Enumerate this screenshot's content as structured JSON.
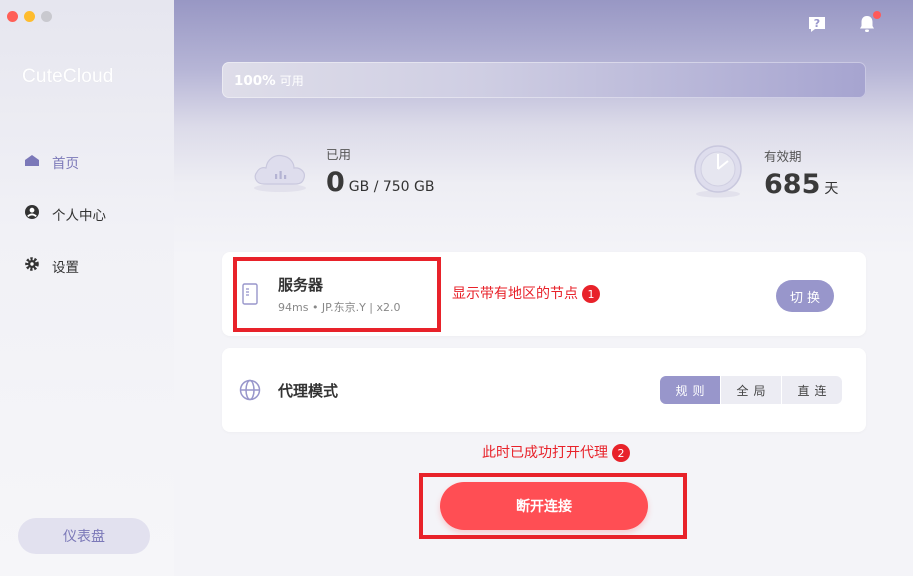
{
  "app": {
    "name": "CuteCloud"
  },
  "window_controls": {
    "colors": [
      "#ff5f57",
      "#febc2e",
      "#c9c9cf"
    ]
  },
  "sidebar": {
    "items": [
      {
        "label": "首页",
        "icon": "home-icon",
        "active": true
      },
      {
        "label": "个人中心",
        "icon": "user-icon",
        "active": false
      },
      {
        "label": "设置",
        "icon": "gear-icon",
        "active": false
      }
    ],
    "dashboard_label": "仪表盘"
  },
  "header": {
    "icons": [
      "help-icon",
      "bell-icon"
    ],
    "has_notification": true
  },
  "usage_bar": {
    "percent_text": "100%",
    "label": "可用",
    "available_fraction": 1.0
  },
  "stats": {
    "used": {
      "label": "已用",
      "value": "0",
      "unit": "GB / 750 GB"
    },
    "validity": {
      "label": "有效期",
      "value": "685",
      "unit": "天"
    }
  },
  "server": {
    "title": "服务器",
    "subtitle": "94ms • JP.东京.Y | x2.0",
    "switch_label": "切换"
  },
  "proxy": {
    "title": "代理模式",
    "modes": [
      "规则",
      "全局",
      "直连"
    ],
    "selected": "规则"
  },
  "annotations": {
    "a1": {
      "text": "显示带有地区的节点",
      "num": "1"
    },
    "a2": {
      "text": "此时已成功打开代理",
      "num": "2"
    }
  },
  "connect": {
    "label": "断开连接"
  },
  "colors": {
    "accent": "#9896cb",
    "danger": "#ff4e54",
    "annotation": "#e8222a"
  }
}
